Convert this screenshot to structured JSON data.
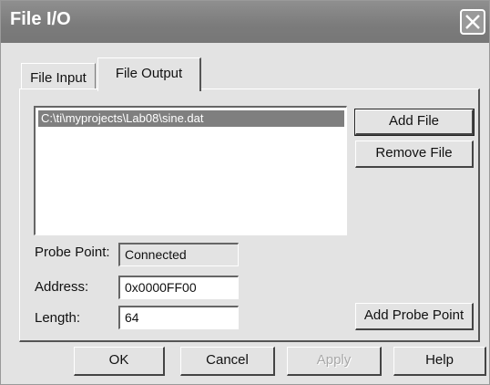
{
  "window": {
    "title": "File I/O",
    "close_icon": "close-icon"
  },
  "tabs": [
    {
      "label": "File Input",
      "active": false
    },
    {
      "label": "File Output",
      "active": true
    }
  ],
  "file_list": {
    "items": [
      "C:\\ti\\myprojects\\Lab08\\sine.dat"
    ],
    "selected_index": 0
  },
  "buttons": {
    "add_file": "Add File",
    "remove_file": "Remove File",
    "add_probe_point": "Add Probe Point",
    "ok": "OK",
    "cancel": "Cancel",
    "apply": "Apply",
    "help": "Help"
  },
  "fields": {
    "probe_point": {
      "label": "Probe Point:",
      "value": "Connected"
    },
    "address": {
      "label": "Address:",
      "value": "0x0000FF00"
    },
    "length": {
      "label": "Length:",
      "value": "64"
    }
  },
  "colors": {
    "title_bar": "#7b7b7b",
    "dialog_bg": "#e3e3e3",
    "selection": "#7f7f7f"
  }
}
